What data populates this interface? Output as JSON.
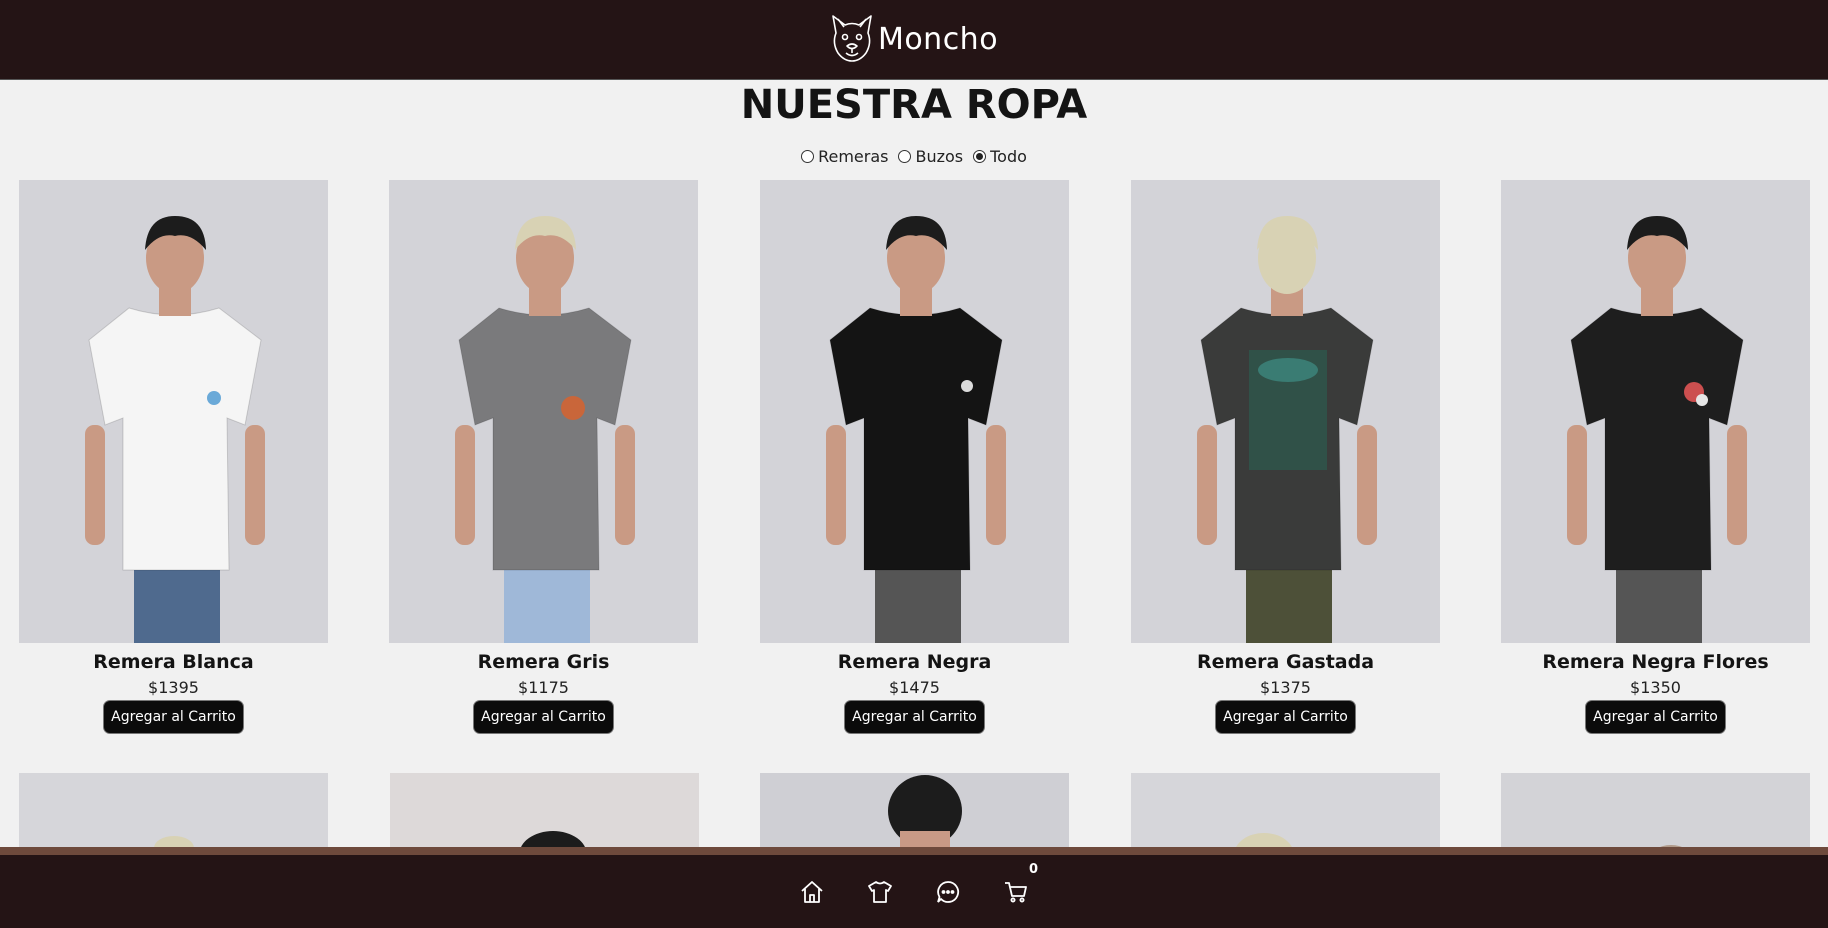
{
  "header": {
    "brand_name": "Moncho",
    "logo_icon": "bulldog-logo-icon"
  },
  "page": {
    "title": "NUESTRA ROPA"
  },
  "filters": [
    {
      "label": "Remeras",
      "checked": false
    },
    {
      "label": "Buzos",
      "checked": false
    },
    {
      "label": "Todo",
      "checked": true
    }
  ],
  "products": [
    {
      "name": "Remera Blanca",
      "price": "$1395",
      "button": "Agregar al Carrito",
      "shirt_color": "#f5f5f5",
      "hair_color": "#1c1c1c"
    },
    {
      "name": "Remera Gris",
      "price": "$1175",
      "button": "Agregar al Carrito",
      "shirt_color": "#7a7a7c",
      "hair_color": "#d8d2b4"
    },
    {
      "name": "Remera Negra",
      "price": "$1475",
      "button": "Agregar al Carrito",
      "shirt_color": "#141414",
      "hair_color": "#1c1c1c"
    },
    {
      "name": "Remera Gastada",
      "price": "$1375",
      "button": "Agregar al Carrito",
      "shirt_color": "#3a3b3a",
      "hair_color": "#d8d2b4"
    },
    {
      "name": "Remera Negra Flores",
      "price": "$1350",
      "button": "Agregar al Carrito",
      "shirt_color": "#1e1e1e",
      "hair_color": "#1c1c1c"
    }
  ],
  "footer_nav": [
    {
      "icon": "home-icon"
    },
    {
      "icon": "tshirt-icon"
    },
    {
      "icon": "chat-icon"
    },
    {
      "icon": "cart-icon",
      "count": "0"
    }
  ],
  "colors": {
    "header_bg": "#241415",
    "page_bg": "#f1f1f1",
    "button_bg": "#0b0b0b",
    "accent_strip": "#6e4a3c"
  }
}
